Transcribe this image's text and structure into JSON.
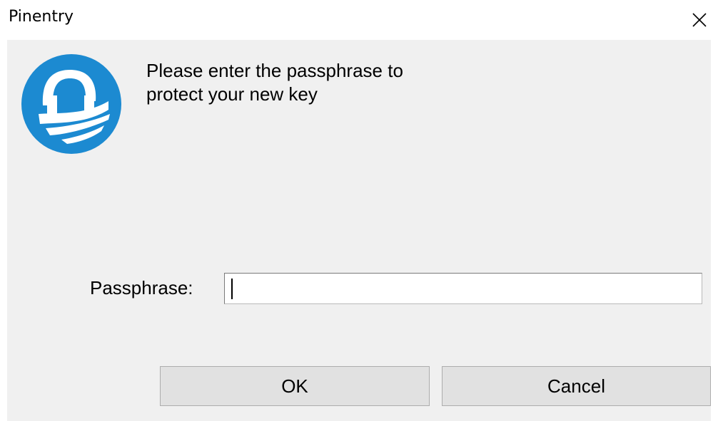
{
  "window": {
    "title": "Pinentry"
  },
  "titlebar": {
    "close_icon": "close-icon"
  },
  "dialog": {
    "logo_icon": "gnupg-lock-icon",
    "description": "Please enter the passphrase to\nprotect your new key",
    "passphrase_label": "Passphrase:",
    "passphrase_value": "",
    "ok_label": "OK",
    "cancel_label": "Cancel"
  },
  "colors": {
    "client_background": "#f0f0f0",
    "logo_blue": "#1c8ad1",
    "button_face": "#e1e1e1",
    "button_border": "#adadad"
  }
}
